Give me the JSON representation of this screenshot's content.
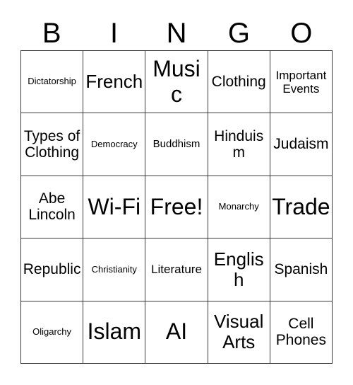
{
  "card": {
    "header_letters": [
      "B",
      "I",
      "N",
      "G",
      "O"
    ],
    "colors": {
      "background": "#ffffff",
      "text": "#000000",
      "grid_line": "#3c3c3c"
    },
    "rows": [
      [
        {
          "text": "Dictatorship",
          "size": "fs-xs"
        },
        {
          "text": "French",
          "size": "fs-xl"
        },
        {
          "text": "Music",
          "size": "fs-xxl"
        },
        {
          "text": "Clothing",
          "size": "fs-l"
        },
        {
          "text": "Important Events",
          "size": "fs-m"
        }
      ],
      [
        {
          "text": "Types of Clothing",
          "size": "fs-l"
        },
        {
          "text": "Democracy",
          "size": "fs-xs"
        },
        {
          "text": "Buddhism",
          "size": "fs-s"
        },
        {
          "text": "Hinduism",
          "size": "fs-l"
        },
        {
          "text": "Judaism",
          "size": "fs-l"
        }
      ],
      [
        {
          "text": "Abe Lincoln",
          "size": "fs-l"
        },
        {
          "text": "Wi-Fi",
          "size": "fs-xxl"
        },
        {
          "text": "Free!",
          "size": "fs-xxl"
        },
        {
          "text": "Monarchy",
          "size": "fs-xs"
        },
        {
          "text": "Trade",
          "size": "fs-xxl"
        }
      ],
      [
        {
          "text": "Republic",
          "size": "fs-l"
        },
        {
          "text": "Christianity",
          "size": "fs-xs"
        },
        {
          "text": "Literature",
          "size": "fs-m"
        },
        {
          "text": "English",
          "size": "fs-xl"
        },
        {
          "text": "Spanish",
          "size": "fs-l"
        }
      ],
      [
        {
          "text": "Oligarchy",
          "size": "fs-xs"
        },
        {
          "text": "Islam",
          "size": "fs-xxl"
        },
        {
          "text": "AI",
          "size": "fs-xxl"
        },
        {
          "text": "Visual Arts",
          "size": "fs-xl"
        },
        {
          "text": "Cell Phones",
          "size": "fs-l"
        }
      ]
    ]
  }
}
